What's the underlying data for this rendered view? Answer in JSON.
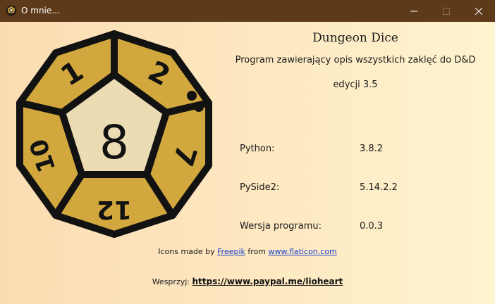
{
  "window": {
    "title": "O mnie...",
    "icon": "d20-dice-icon",
    "controls": [
      "minimize-icon",
      "maximize-icon",
      "close-icon"
    ]
  },
  "about": {
    "app_name": "Dungeon Dice",
    "description": "Program zawierający opis wszystkich zaklęć do D&D",
    "edition": "edycji 3.5"
  },
  "dice": {
    "icon": "d12-dice-icon",
    "faces": [
      "8",
      "2",
      "7",
      "12",
      "10",
      "1"
    ],
    "colors": {
      "body": "#d2a83e",
      "center": "#ebdcb3",
      "outline": "#121212"
    }
  },
  "info": [
    {
      "label": "Python:",
      "value": "3.8.2"
    },
    {
      "label": "PySide2:",
      "value": "5.14.2.2"
    },
    {
      "label": "Wersja programu:",
      "value": "0.0.3"
    }
  ],
  "credits": {
    "prefix": "Icons made by",
    "author": "Freepik",
    "middle": "from",
    "site": "www.flaticon.com"
  },
  "support": {
    "label": "Wesprzyj:",
    "link": "https://www.paypal.me/lioheart"
  },
  "colors": {
    "titlebar": "#5d3a1a",
    "link": "#1a3fcf",
    "background_left": "#fbdcb2",
    "background_right": "#fef4cf"
  }
}
